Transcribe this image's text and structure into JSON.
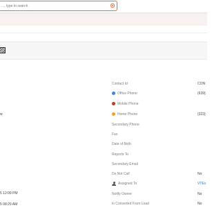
{
  "search": {
    "placeholder": "..., type to search"
  },
  "left_column": {
    "fragment_w": "w",
    "created_time": "5 12:09 PM",
    "modified_time": "5 08:29 AM"
  },
  "fields": [
    {
      "label": "Contact Id",
      "value": "CON",
      "icon": ""
    },
    {
      "label": "Office Phone",
      "value": "(639)",
      "icon": "office-phone-icon"
    },
    {
      "label": "Mobile Phone",
      "value": "",
      "icon": "mobile-phone-icon"
    },
    {
      "label": "Home Phone",
      "value": "(323)",
      "icon": "home-phone-icon"
    },
    {
      "label": "Secondary Phone",
      "value": "",
      "icon": ""
    },
    {
      "label": "Fax",
      "value": "",
      "icon": ""
    },
    {
      "label": "Date of Birth",
      "value": "",
      "icon": ""
    },
    {
      "label": "Reports To",
      "value": "",
      "icon": ""
    },
    {
      "label": "Secondary Email",
      "value": "",
      "icon": ""
    },
    {
      "label": "Do Not Call",
      "value": "No",
      "icon": ""
    },
    {
      "label": "Assigned To",
      "value": "VTEx",
      "icon": "user-icon"
    },
    {
      "label": "Notify Owner",
      "value": "No",
      "icon": ""
    },
    {
      "label": "Is Converted From Lead",
      "value": "No",
      "icon": ""
    }
  ],
  "colors": {
    "accent": "#e66a3a",
    "link": "#2a74c9",
    "office_icon": "#3f86d6",
    "mobile_icon": "#c0392b",
    "home_icon": "#f0a02a"
  }
}
